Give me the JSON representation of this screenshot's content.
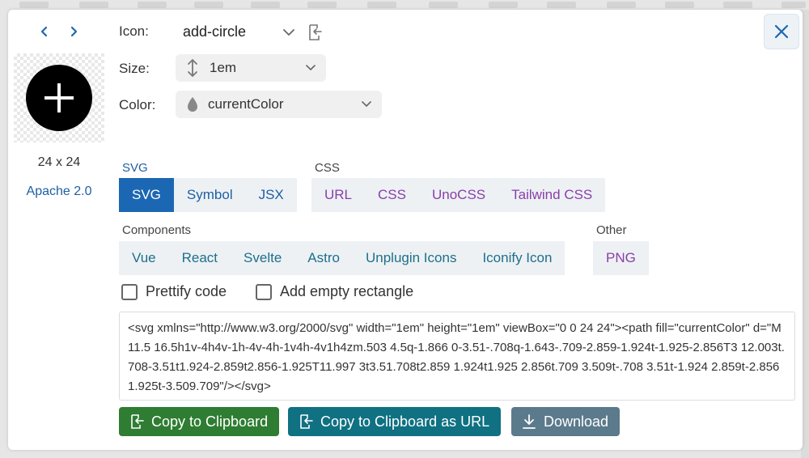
{
  "nav": {
    "prev_icon": "chevron-left-icon",
    "next_icon": "chevron-right-icon"
  },
  "preview": {
    "icon_name": "add-circle-icon",
    "dimensions": "24 x 24",
    "license": "Apache 2.0"
  },
  "fields": {
    "icon": {
      "label": "Icon:",
      "value": "add-circle"
    },
    "size": {
      "label": "Size:",
      "value": "1em"
    },
    "color": {
      "label": "Color:",
      "value": "currentColor"
    }
  },
  "sections": {
    "svg": {
      "title": "SVG",
      "tabs": [
        "SVG",
        "Symbol",
        "JSX"
      ],
      "active": "SVG"
    },
    "css": {
      "title": "CSS",
      "tabs": [
        "URL",
        "CSS",
        "UnoCSS",
        "Tailwind CSS"
      ]
    },
    "components": {
      "title": "Components",
      "tabs": [
        "Vue",
        "React",
        "Svelte",
        "Astro",
        "Unplugin Icons",
        "Iconify Icon"
      ]
    },
    "other": {
      "title": "Other",
      "tabs": [
        "PNG"
      ]
    }
  },
  "options": {
    "prettify": "Prettify code",
    "empty_rect": "Add empty rectangle"
  },
  "code": "<svg xmlns=\"http://www.w3.org/2000/svg\" width=\"1em\" height=\"1em\" viewBox=\"0 0 24 24\"><path fill=\"currentColor\" d=\"M11.5 16.5h1v-4h4v-1h-4v-4h-1v4h-4v1h4zm.503 4.5q-1.866 0-3.51-.708q-1.643-.709-2.859-1.924t-1.925-2.856T3 12.003t.708-3.51t1.924-2.859t2.856-1.925T11.997 3t3.51.708t2.859 1.924t1.925 2.856t.709 3.509t-.708 3.51t-1.924 2.859t-2.856 1.925t-3.509.709\"/></svg>",
  "actions": {
    "copy": "Copy to Clipboard",
    "copy_url": "Copy to Clipboard as URL",
    "download": "Download"
  },
  "colors": {
    "copy": "#2e7d32",
    "copy_url": "#0f7182",
    "download": "#5b7a8c",
    "active_tab": "#1c67b3"
  }
}
